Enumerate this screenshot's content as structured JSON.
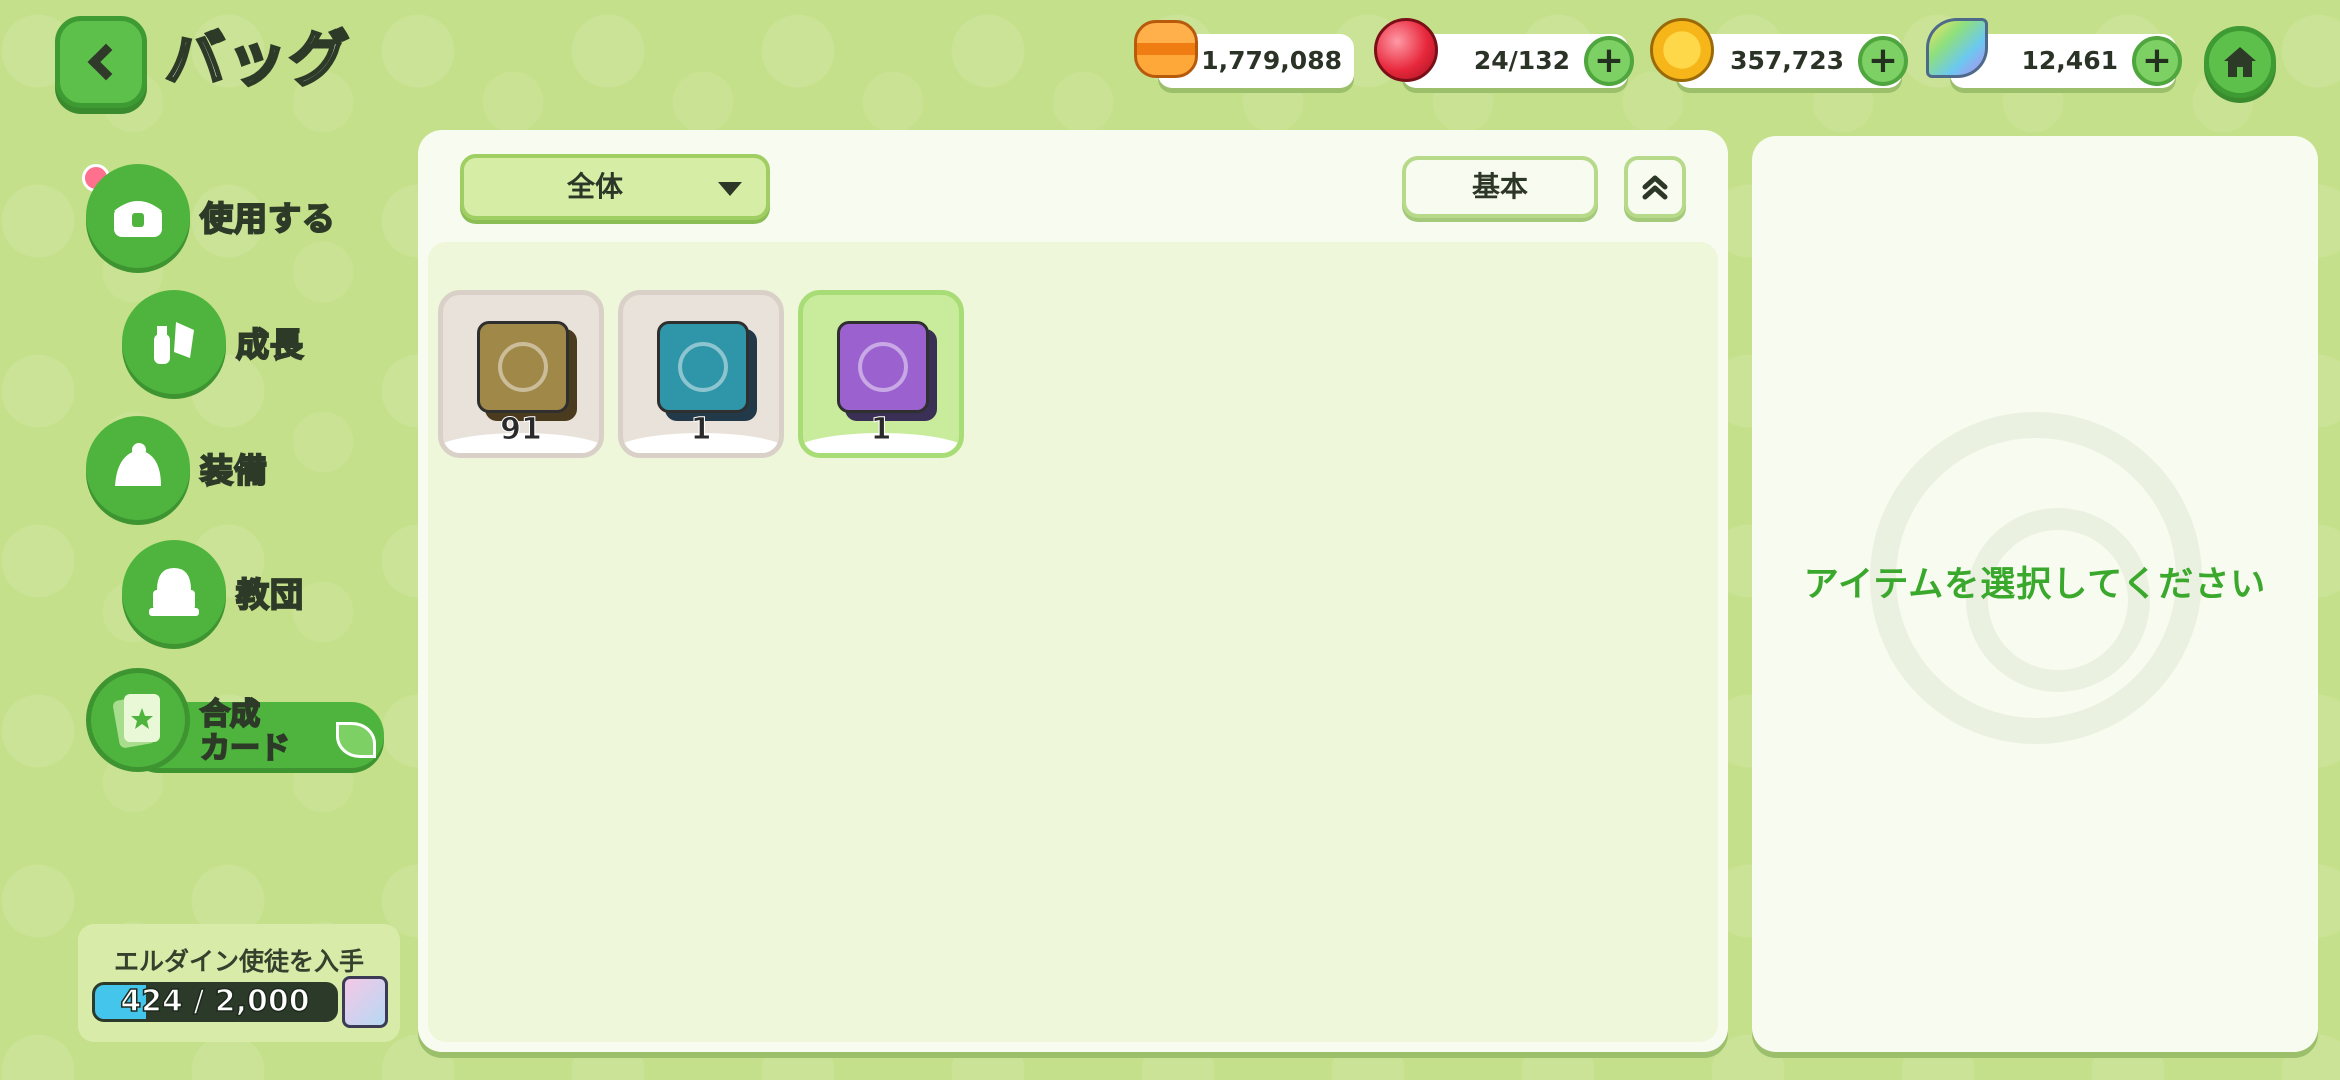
{
  "header": {
    "title": "バッグ",
    "back_icon": "chevron-left-icon",
    "home_icon": "home-icon"
  },
  "currencies": [
    {
      "name": "macaron",
      "icon": "macaron-icon",
      "value": "1,779,088",
      "has_plus": false,
      "color": "#f5821f"
    },
    {
      "name": "stamina",
      "icon": "red-gem-icon",
      "value": "24/132",
      "has_plus": true,
      "color": "#e8283c"
    },
    {
      "name": "gold",
      "icon": "gold-coin-icon",
      "value": "357,723",
      "has_plus": true,
      "color": "#f6b619"
    },
    {
      "name": "crystal",
      "icon": "rainbow-leaf-icon",
      "value": "12,461",
      "has_plus": true,
      "color": "#8fd0ee"
    }
  ],
  "plus_label": "+",
  "sidebar": {
    "items": [
      {
        "label": "使用する",
        "icon": "treasure-chest-icon",
        "badge": true
      },
      {
        "label": "成長",
        "icon": "potion-crystal-icon",
        "badge": false
      },
      {
        "label": "装備",
        "icon": "bell-hat-icon",
        "badge": false
      },
      {
        "label": "教団",
        "icon": "temple-icon",
        "badge": false
      },
      {
        "label": "合成\nカード",
        "label_line1": "合成",
        "label_line2": "カード",
        "icon": "card-icon",
        "active": true
      }
    ]
  },
  "progress": {
    "title": "エルダイン使徒を入手",
    "current": 424,
    "max": 2000,
    "text": "424 / 2,000",
    "fraction": 0.212,
    "reward_icon": "card-pack-icon"
  },
  "toolbar": {
    "filter_value": "全体",
    "sort_label": "基本",
    "order_icon": "double-chevron-up-icon"
  },
  "items": [
    {
      "qty": "91",
      "card_color": "#a08848",
      "back_color": "#4a3b1e",
      "selected": false
    },
    {
      "qty": "1",
      "card_color": "#2f95a8",
      "back_color": "#22394a",
      "selected": false
    },
    {
      "qty": "1",
      "card_color": "#9b62cf",
      "back_color": "#3a2f55",
      "selected": true
    }
  ],
  "detail": {
    "hint": "アイテムを選択してください"
  }
}
